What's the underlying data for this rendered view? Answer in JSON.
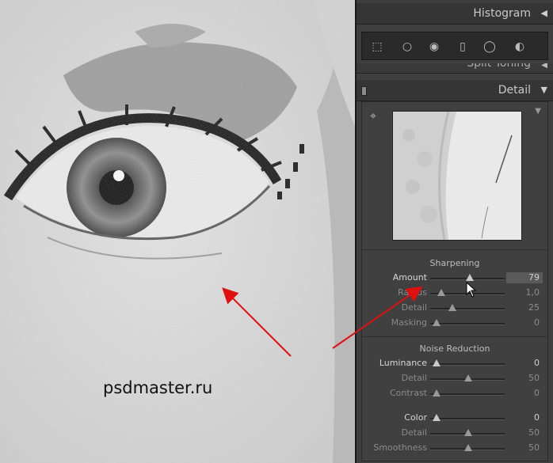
{
  "watermark": "psdmaster.ru",
  "panel": {
    "histogram_title": "Histogram",
    "split_toning_title": "Split Toning",
    "detail_title": "Detail",
    "tools": [
      {
        "name": "crop-overlay-icon",
        "glyph": "⬚"
      },
      {
        "name": "spot-removal-icon",
        "glyph": "○"
      },
      {
        "name": "red-eye-icon",
        "glyph": "◉"
      },
      {
        "name": "graduated-filter-icon",
        "glyph": "▯"
      },
      {
        "name": "radial-filter-icon",
        "glyph": "◯"
      },
      {
        "name": "adjustment-brush-icon",
        "glyph": "◐"
      }
    ],
    "sharpening": {
      "title": "Sharpening",
      "sliders": [
        {
          "label": "Amount",
          "value": "79",
          "pos": 0.53
        },
        {
          "label": "Radius",
          "value": "1,0",
          "pos": 0.08
        },
        {
          "label": "Detail",
          "value": "25",
          "pos": 0.25
        },
        {
          "label": "Masking",
          "value": "0",
          "pos": 0.0
        }
      ]
    },
    "noise": {
      "title": "Noise Reduction",
      "sliders": [
        {
          "label": "Luminance",
          "value": "0",
          "pos": 0.0
        },
        {
          "label": "Detail",
          "value": "50",
          "pos": 0.5
        },
        {
          "label": "Contrast",
          "value": "0",
          "pos": 0.0
        },
        {
          "label": "Color",
          "value": "0",
          "pos": 0.0
        },
        {
          "label": "Detail",
          "value": "50",
          "pos": 0.5
        },
        {
          "label": "Smoothness",
          "value": "50",
          "pos": 0.5
        }
      ]
    }
  }
}
